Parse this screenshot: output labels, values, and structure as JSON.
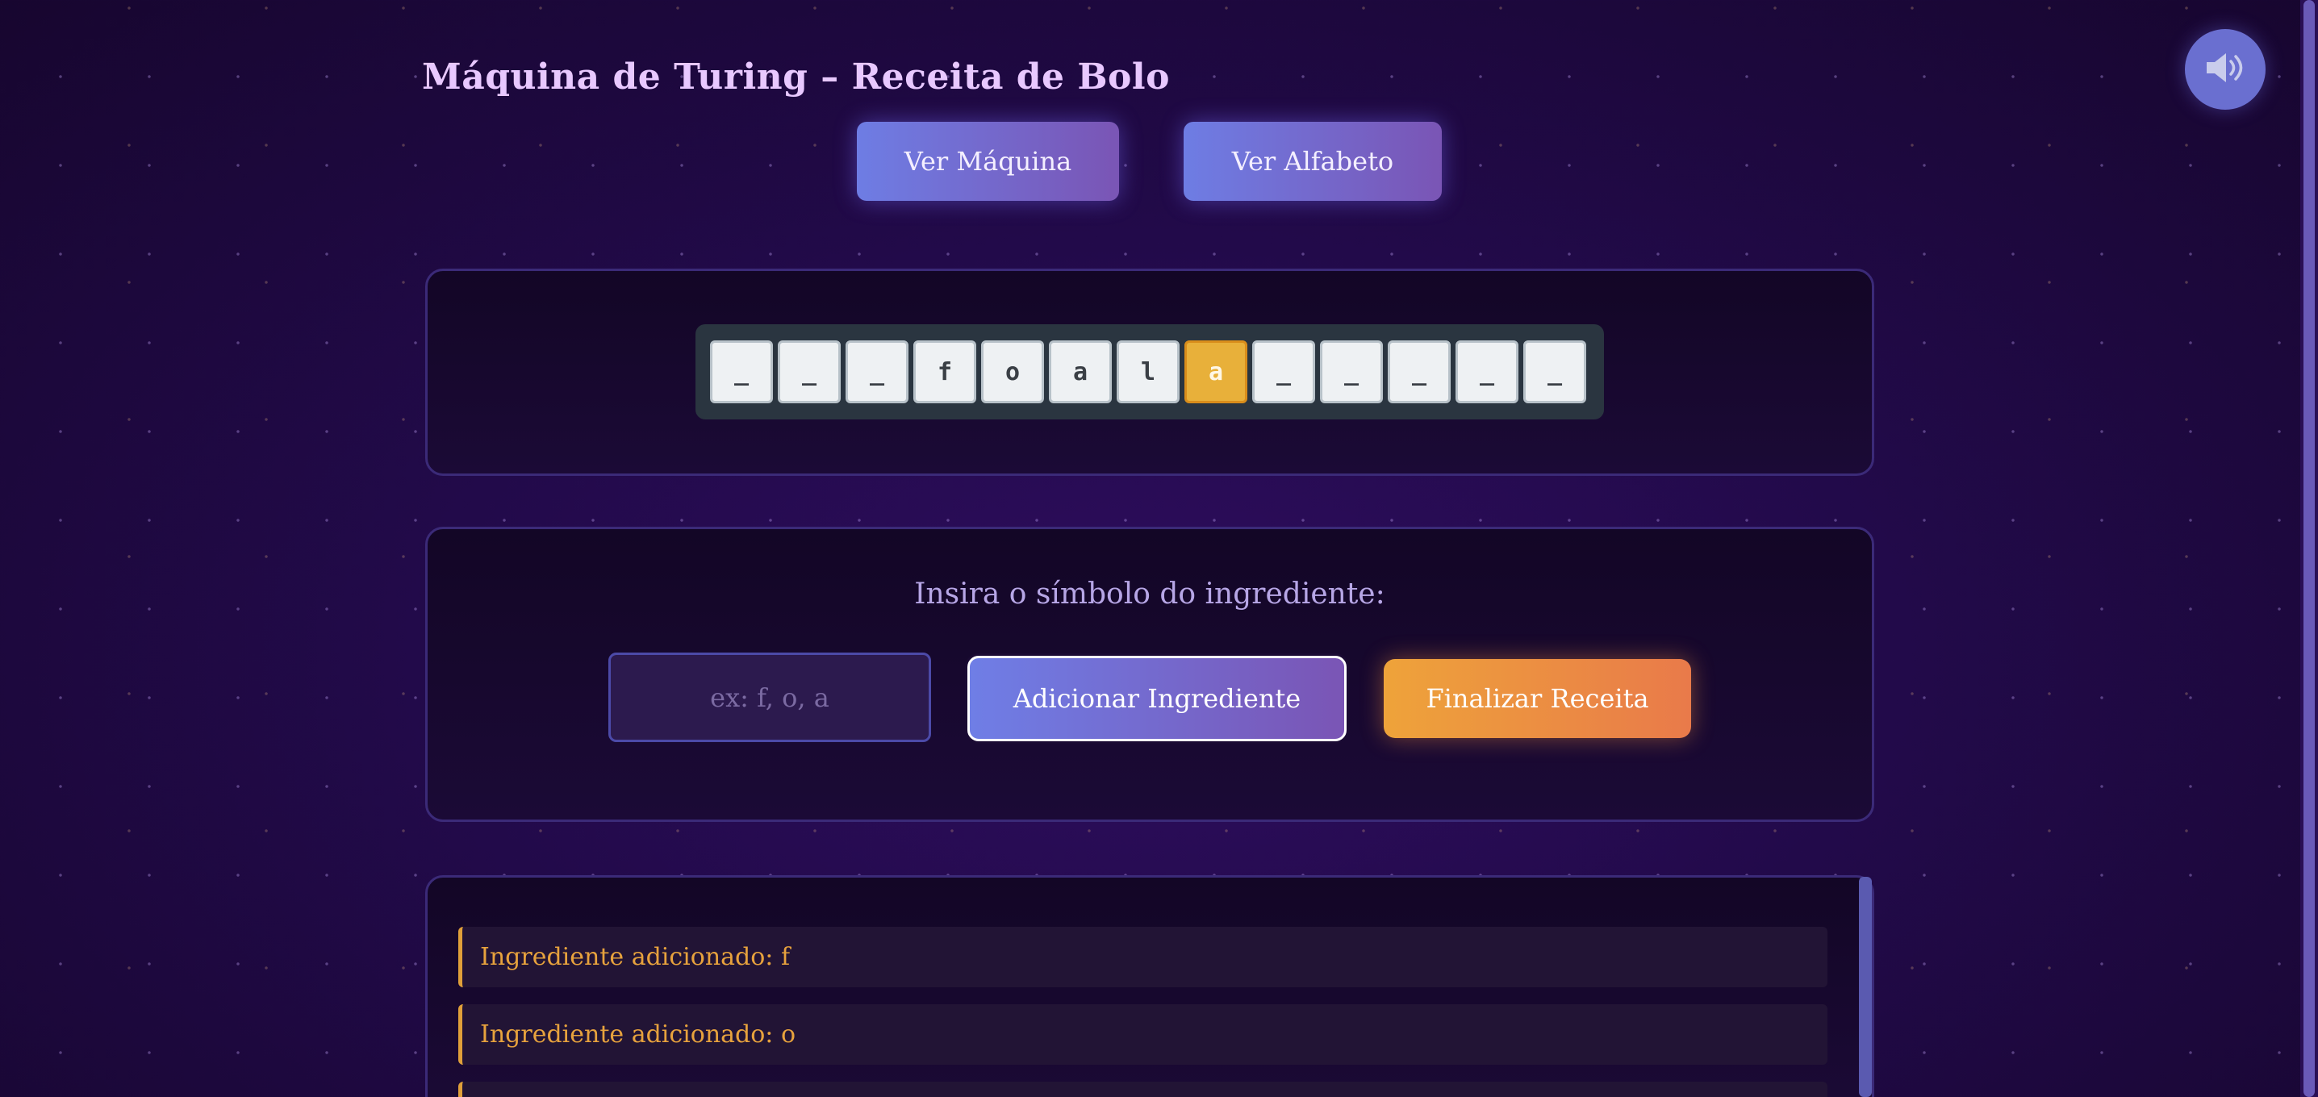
{
  "header": {
    "title": "Máquina de Turing – Receita de Bolo",
    "sound_icon": "speaker-icon"
  },
  "nav": {
    "view_machine_label": "Ver Máquina",
    "view_alphabet_label": "Ver Alfabeto"
  },
  "tape": {
    "cells": [
      "_",
      "_",
      "_",
      "f",
      "o",
      "a",
      "l",
      "a",
      "_",
      "_",
      "_",
      "_",
      "_"
    ],
    "head_index": 7
  },
  "input_panel": {
    "prompt": "Insira o símbolo do ingrediente:",
    "placeholder": "ex: f, o, a",
    "add_label": "Adicionar Ingrediente",
    "finish_label": "Finalizar Receita"
  },
  "log": {
    "entries": [
      "Ingrediente adicionado: f",
      "Ingrediente adicionado: o"
    ]
  },
  "colors": {
    "accent": "#e7a23d",
    "button_gradient_start": "#6e7de4",
    "button_gradient_end": "#7a55b5",
    "finish_gradient_start": "#eea33a",
    "finish_gradient_end": "#e97a4a"
  }
}
